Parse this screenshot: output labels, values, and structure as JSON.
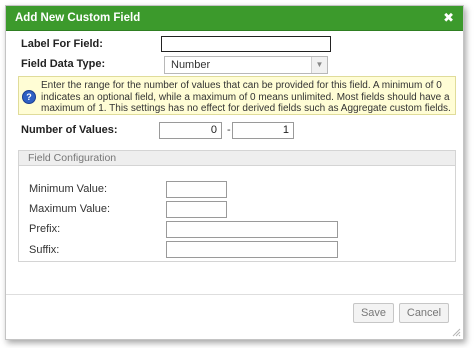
{
  "dialog": {
    "title": "Add New Custom Field",
    "close_glyph": "✖",
    "close_icon": "close-icon"
  },
  "form": {
    "label_for_field": {
      "label": "Label For Field:",
      "value": ""
    },
    "field_data_type": {
      "label": "Field Data Type:",
      "selected": "Number",
      "arrow": "▼"
    },
    "info": {
      "icon": "help-icon",
      "icon_glyph": "?",
      "text": "Enter the range for the number of values that can be provided for this field. A minimum of 0 indicates an optional field, while a maximum of 0 means unlimited. Most fields should have a maximum of 1. This settings has no effect for derived fields such as Aggregate custom fields."
    },
    "number_of_values": {
      "label": "Number of Values:",
      "min": "0",
      "separator": "-",
      "max": "1"
    }
  },
  "field_configuration": {
    "legend": "Field Configuration",
    "minimum_value": {
      "label": "Minimum Value:",
      "value": ""
    },
    "maximum_value": {
      "label": "Maximum Value:",
      "value": ""
    },
    "prefix": {
      "label": "Prefix:",
      "value": ""
    },
    "suffix": {
      "label": "Suffix:",
      "value": ""
    }
  },
  "footer": {
    "save_label": "Save",
    "cancel_label": "Cancel"
  }
}
